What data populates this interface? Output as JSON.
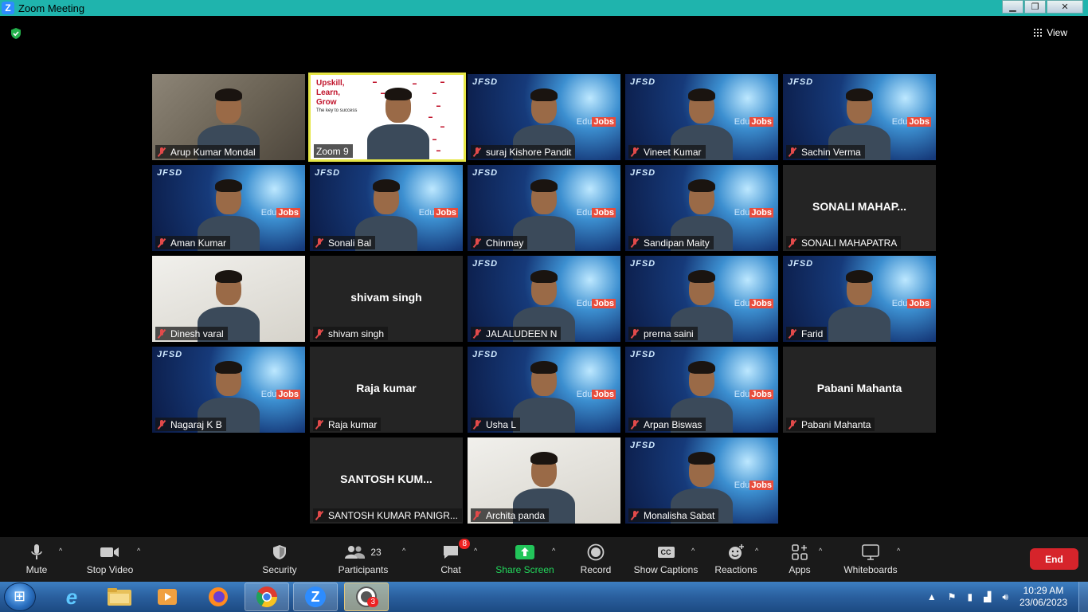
{
  "window": {
    "title": "Zoom Meeting",
    "minimize": "▁",
    "maximize": "❐",
    "close": "✕"
  },
  "view_label": "View",
  "participants": [
    {
      "name": "Arup Kumar Mondal",
      "video": "room",
      "active": false
    },
    {
      "name": "Zoom 9",
      "video": "slide",
      "active": true
    },
    {
      "name": "suraj Kishore Pandit",
      "video": "jfsd",
      "active": false
    },
    {
      "name": "Vineet Kumar",
      "video": "jfsd",
      "active": false
    },
    {
      "name": "Sachin Verma",
      "video": "jfsd",
      "active": false
    },
    {
      "name": "Aman Kumar",
      "video": "jfsd",
      "active": false
    },
    {
      "name": "Sonali Bal",
      "video": "jfsd",
      "active": false
    },
    {
      "name": "Chinmay",
      "video": "jfsd",
      "active": false
    },
    {
      "name": "Sandipan Maity",
      "video": "jfsd",
      "active": false
    },
    {
      "name": "SONALI MAHAPATRA",
      "video": "none",
      "display": "SONALI  MAHAP...",
      "active": false
    },
    {
      "name": "Dinesh varal",
      "video": "wall",
      "active": false
    },
    {
      "name": "shivam singh",
      "video": "none",
      "display": "shivam singh",
      "active": false
    },
    {
      "name": "JALALUDEEN N",
      "video": "jfsd",
      "active": false
    },
    {
      "name": "prerna saini",
      "video": "jfsd",
      "active": false
    },
    {
      "name": "Farid",
      "video": "jfsd",
      "active": false
    },
    {
      "name": "Nagaraj K B",
      "video": "jfsd",
      "active": false
    },
    {
      "name": "Raja kumar",
      "video": "none",
      "display": "Raja kumar",
      "active": false
    },
    {
      "name": "Usha L",
      "video": "jfsd",
      "active": false
    },
    {
      "name": "Arpan Biswas",
      "video": "jfsd",
      "active": false
    },
    {
      "name": "Pabani Mahanta",
      "video": "none",
      "display": "Pabani Mahanta",
      "active": false
    },
    {
      "name": "SANTOSH KUMAR PANIGR...",
      "video": "none",
      "display": "SANTOSH  KUM...",
      "active": false
    },
    {
      "name": "Archita panda",
      "video": "wall",
      "active": false
    },
    {
      "name": "Monalisha Sabat",
      "video": "jfsd",
      "active": false
    }
  ],
  "background_text": {
    "jfsd": "JFSD",
    "edu": "Edu",
    "jobs": "Jobs"
  },
  "slide": {
    "title_lines": [
      "Upskill,",
      "Learn,",
      "Grow"
    ],
    "subtitle": "The key to success"
  },
  "toolbar": {
    "mute": "Mute",
    "stop_video": "Stop Video",
    "security": "Security",
    "participants": "Participants",
    "participants_count": "23",
    "chat": "Chat",
    "chat_badge": "8",
    "share_screen": "Share Screen",
    "record": "Record",
    "show_captions": "Show Captions",
    "captions_icon_text": "CC",
    "reactions": "Reactions",
    "apps": "Apps",
    "whiteboards": "Whiteboards",
    "end": "End",
    "caret": "^"
  },
  "taskbar": {
    "whatsapp_badge": "3",
    "time": "10:29 AM",
    "date": "23/06/2023"
  },
  "colors": {
    "title_bar": "#1fb4ad",
    "active_border": "#e6e645",
    "end_button": "#d6242b",
    "share_green": "#22d85c",
    "mic_muted": "#e24a4a"
  }
}
